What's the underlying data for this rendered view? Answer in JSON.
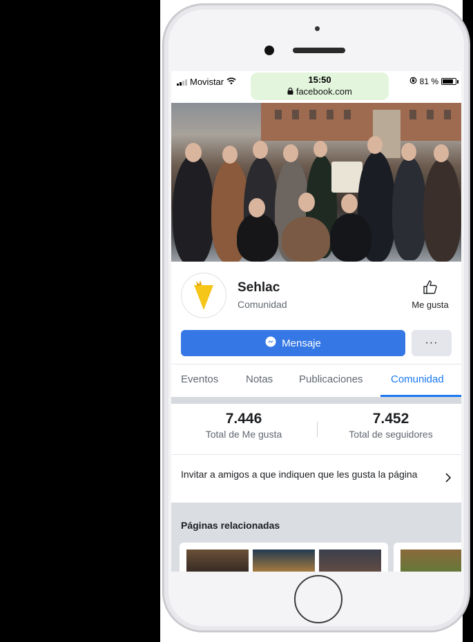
{
  "status_bar": {
    "carrier": "Movistar",
    "time": "15:50",
    "url": "facebook.com",
    "battery": "81 %",
    "battery_level": 0.81
  },
  "page": {
    "name": "Sehlac",
    "category": "Comunidad",
    "like_label": "Me gusta",
    "message_button": "Mensaje",
    "more_button": "···"
  },
  "tabs": [
    {
      "label": "Eventos"
    },
    {
      "label": "Notas"
    },
    {
      "label": "Publicaciones"
    },
    {
      "label": "Comunidad",
      "active": true
    }
  ],
  "stats": {
    "likes": {
      "value": "7.446",
      "label": "Total de Me gusta"
    },
    "followers": {
      "value": "7.452",
      "label": "Total de seguidores"
    }
  },
  "invite": {
    "text": "Invitar a amigos a que indiquen que les gusta la página"
  },
  "related": {
    "title": "Páginas relacionadas"
  },
  "colors": {
    "accent": "#1877f2",
    "message_button": "#3578e5",
    "url_bar": "#e3f5dc",
    "logo_yellow": "#f5c518"
  }
}
